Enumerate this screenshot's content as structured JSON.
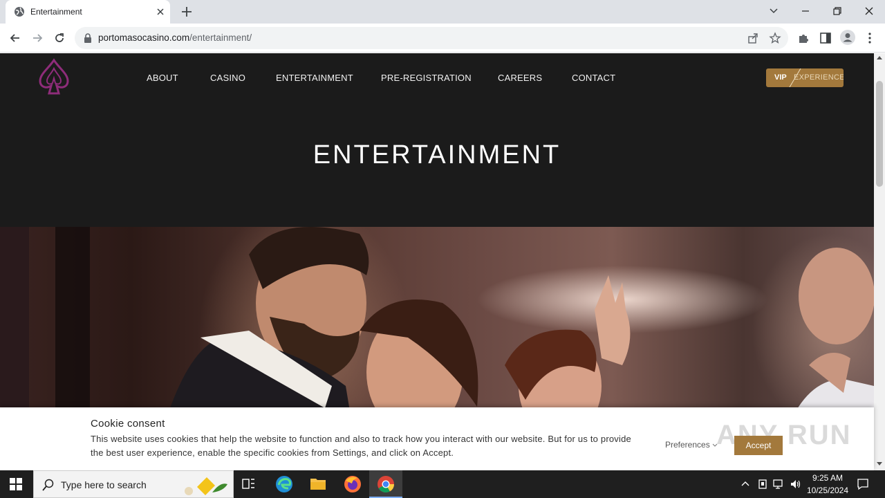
{
  "browser": {
    "tab_title": "Entertainment",
    "url_domain": "portomasocasino.com",
    "url_path": "/entertainment/"
  },
  "site": {
    "nav": [
      "ABOUT",
      "CASINO",
      "ENTERTAINMENT",
      "PRE-REGISTRATION",
      "CAREERS",
      "CONTACT"
    ],
    "vip_strong": "VIP",
    "vip_light": "EXPERIENCE",
    "hero_title": "ENTERTAINMENT",
    "accent": "#a3793c",
    "logo_color": "#8e2c7a"
  },
  "cookie": {
    "title": "Cookie consent",
    "text": "This website uses cookies that help the website to function and also to track how you interact with our website. But for us to provide the best user experience, enable the specific cookies from Settings, and click on Accept.",
    "preferences": "Preferences",
    "accept": "Accept",
    "watermark": "ANY RUN"
  },
  "taskbar": {
    "search_placeholder": "Type here to search",
    "time": "9:25 AM",
    "date": "10/25/2024"
  }
}
